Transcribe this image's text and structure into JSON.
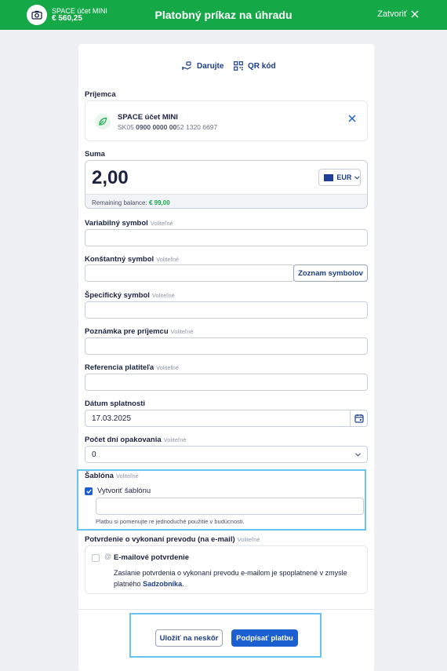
{
  "header": {
    "account_name": "SPACE účet MINI",
    "account_balance": "€ 560,25",
    "title": "Platobný príkaz na úhradu",
    "close_label": "Zatvoriť"
  },
  "quick_links": {
    "donate": "Darujte",
    "qr": "QR kód"
  },
  "recipient": {
    "label": "Príjemca",
    "name": "SPACE účet MINI",
    "iban_prefix": "SK05",
    "iban_bold": "0900 0000 00",
    "iban_rest": "52 1320 6697"
  },
  "amount": {
    "label": "Suma",
    "value": "2,00",
    "currency": "EUR",
    "remaining_label": "Remaining balance:",
    "remaining_value": "€ 99,00"
  },
  "optional_tag": "Voliteľné",
  "fields": {
    "variable_symbol": {
      "label": "Variabilný symbol",
      "value": ""
    },
    "constant_symbol": {
      "label": "Konštantný symbol",
      "value": "",
      "button": "Zoznam symbolov"
    },
    "specific_symbol": {
      "label": "Špecifický symbol",
      "value": ""
    },
    "note": {
      "label": "Poznámka pre príjemcu",
      "value": ""
    },
    "payer_reference": {
      "label": "Referencia platiteľa",
      "value": ""
    },
    "due_date": {
      "label": "Dátum splatnosti",
      "value": "17.03.2025"
    },
    "repeat_days": {
      "label": "Počet dní opakovania",
      "value": "0"
    }
  },
  "template": {
    "label": "Šablóna",
    "checkbox_label": "Vytvoriť šablónu",
    "checked": true,
    "name_value": "",
    "hint": "Platbu si pomenujte re jednoduché použitie v budúcnosti."
  },
  "confirmation": {
    "label": "Potvrdenie o vykonaní prevodu (na e-mail)",
    "option_label": "E-mailové potvrdenie",
    "checked": false,
    "description": "Zaslanie potvrdenia o vykonaní prevodu e-mailom je spoplatnené v zmysle platného",
    "link_text": "Sadzobníka",
    "suffix": "."
  },
  "actions": {
    "save_later": "Uložiť na neskôr",
    "sign": "Podpísať platbu"
  },
  "colors": {
    "header_bg": "#14a847",
    "primary": "#1b5fd0",
    "link": "#1b3d88",
    "highlight": "#67c4ef"
  }
}
